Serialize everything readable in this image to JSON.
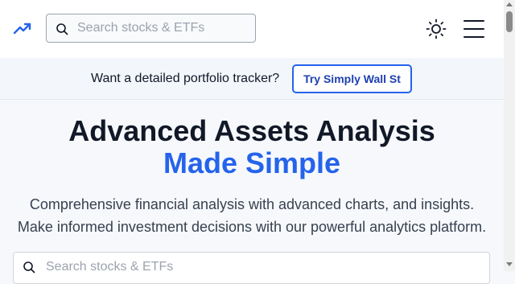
{
  "header": {
    "logo_icon": "trending-up-icon",
    "search_placeholder": "Search stocks & ETFs",
    "theme_icon": "sun-icon",
    "menu_icon": "hamburger-menu-icon"
  },
  "banner": {
    "text": "Want a detailed portfolio tracker?",
    "button_label": "Try Simply Wall St"
  },
  "hero": {
    "title": "Advanced Assets Analysis",
    "subtitle": "Made Simple",
    "description_line1": "Comprehensive financial analysis with advanced charts, and insights.",
    "description_line2": "Make informed investment decisions with our powerful analytics platform."
  },
  "main_search": {
    "placeholder": "Search stocks & ETFs"
  },
  "colors": {
    "accent": "#2563eb",
    "text": "#111827",
    "background": "#f6f8fb"
  }
}
